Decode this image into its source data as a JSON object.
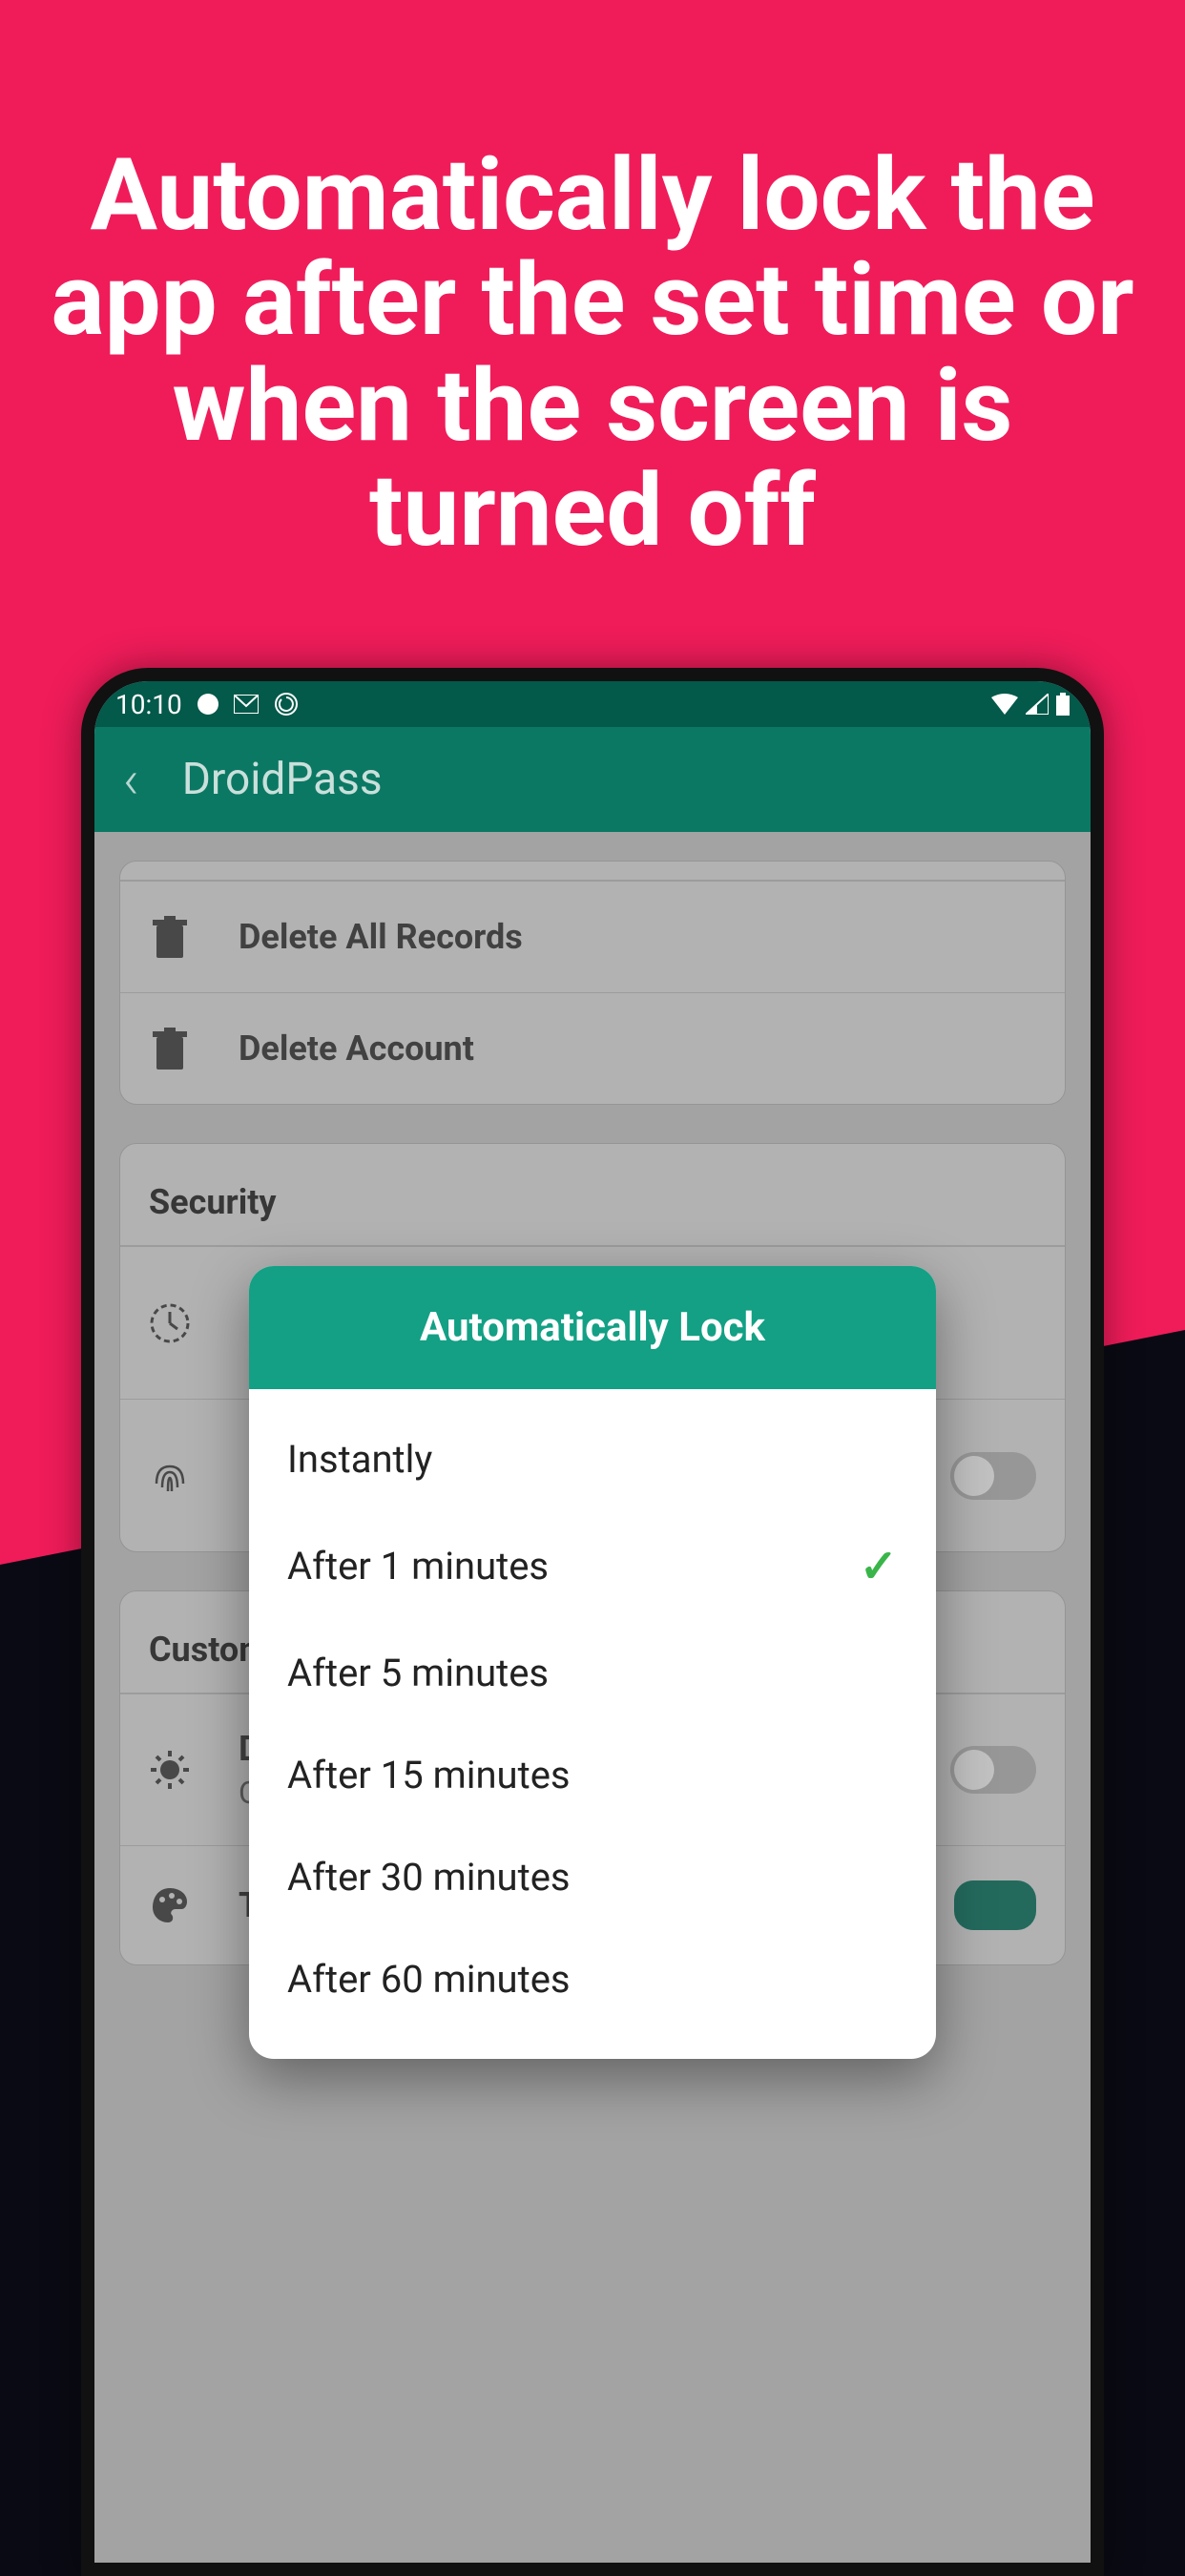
{
  "hero": "Automatically lock the app after the set time or when the screen is turned off",
  "status": {
    "time": "10:10"
  },
  "appbar": {
    "title": "DroidPass"
  },
  "settings": {
    "deleteRecords": "Delete All Records",
    "deleteAccount": "Delete Account",
    "securityHeader": "Security",
    "customHeader": "Customization",
    "darkMode": {
      "label": "Dark Mode",
      "value": "Off"
    },
    "theme": {
      "label": "Theme"
    }
  },
  "dialog": {
    "title": "Automatically Lock",
    "options": [
      {
        "label": "Instantly",
        "selected": false
      },
      {
        "label": "After 1 minutes",
        "selected": true
      },
      {
        "label": "After 5 minutes",
        "selected": false
      },
      {
        "label": "After 15 minutes",
        "selected": false
      },
      {
        "label": "After 30 minutes",
        "selected": false
      },
      {
        "label": "After 60 minutes",
        "selected": false
      }
    ]
  }
}
